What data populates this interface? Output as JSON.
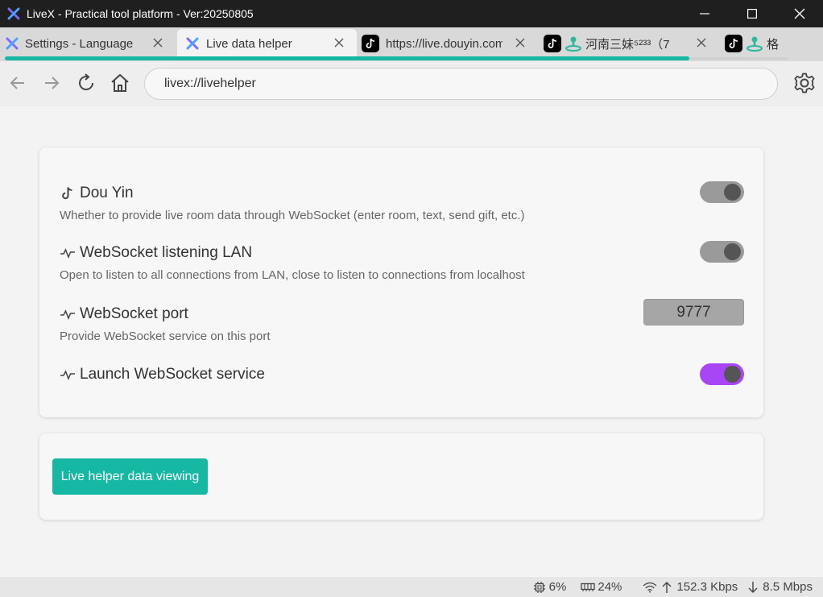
{
  "window": {
    "title": "LiveX - Practical tool platform - Ver:20250805"
  },
  "tabs": [
    {
      "label": "Settings - Language",
      "icon": "livex-logo-icon"
    },
    {
      "label": "Live data helper",
      "icon": "livex-logo-icon"
    },
    {
      "label": "https://live.douyin.com/",
      "icon": "tiktok-icon"
    },
    {
      "label": "河南三妹⁵²³³（7",
      "icon": "tiktok-icon"
    },
    {
      "label": "格",
      "icon": "tiktok-icon"
    }
  ],
  "address_bar": {
    "url": "livex://livehelper"
  },
  "settings": {
    "douyin": {
      "title": "Dou Yin",
      "description": "Whether to provide live room data through WebSocket (enter room, text, send gift, etc.)",
      "enabled": true
    },
    "lan": {
      "title": "WebSocket listening LAN",
      "description": "Open to listen to all connections from LAN, close to listen to connections from localhost",
      "enabled": true
    },
    "port": {
      "title": "WebSocket port",
      "description": "Provide WebSocket service on this port",
      "value": "9777"
    },
    "launch": {
      "title": "Launch WebSocket service",
      "enabled": true
    }
  },
  "actions": {
    "view_button": "Live helper data viewing"
  },
  "status_bar": {
    "cpu": "6%",
    "memory": "24%",
    "upload": "152.3 Kbps",
    "download": "8.5 Mbps"
  },
  "colors": {
    "accent": "#16b8a4",
    "toggle_on": "#a845f5",
    "toggle_off": "#9a9a9a"
  }
}
